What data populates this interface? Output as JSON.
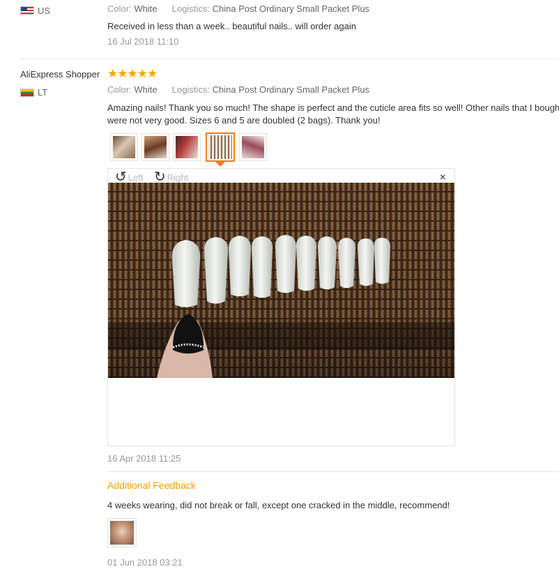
{
  "reviews": [
    {
      "country": "US",
      "color_label": "Color:",
      "color_value": "White",
      "logistics_label": "Logistics:",
      "logistics_value": "China Post Ordinary Small Packet Plus",
      "text": "Received in less than a week.. beautiful nails.. will order again",
      "date": "16 Jul 2018 11:10"
    },
    {
      "user": "AliExpress Shopper",
      "stars": "★★★★★",
      "rating": 5,
      "country": "LT",
      "color_label": "Color:",
      "color_value": "White",
      "logistics_label": "Logistics:",
      "logistics_value": "China Post Ordinary Small Packet Plus",
      "text": "Amazing nails! Thank you so much! The shape is perfect and the cuticle area fits so well! Other nails that I bought",
      "text_line2": "were not very good. Sizes 6 and 5 are doubled (2 bags). Thank you!",
      "date": "16 Apr 2018 11:25",
      "viewer": {
        "rotate_left_label": "Left",
        "rotate_right_label": "Right",
        "close_symbol": "×"
      },
      "additional_feedback": {
        "title": "Additional Feedback",
        "text": "4 weeks wearing, did not break or fall, except one cracked in the middle, recommend!",
        "date": "01 Jun 2018 03:21"
      }
    }
  ],
  "colors": {
    "accent_orange": "#f57b18",
    "star_yellow": "#f7a600",
    "feedback_title": "#f5a000"
  }
}
